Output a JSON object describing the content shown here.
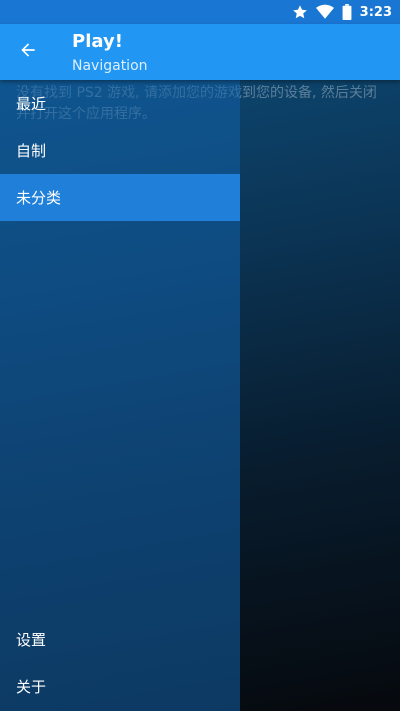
{
  "status_bar": {
    "time": "3:23",
    "icons": [
      "star-icon",
      "wifi-icon",
      "battery-icon"
    ]
  },
  "app_bar": {
    "title": "Play!",
    "subtitle": "Navigation",
    "back_icon": "arrow-left-icon"
  },
  "main": {
    "empty_message": "没有找到 PS2 游戏, 请添加您的游戏到您的设备, 然后关闭并打开这个应用程序。"
  },
  "drawer": {
    "items": [
      {
        "label": "最近"
      },
      {
        "label": "自制"
      },
      {
        "label": "未分类",
        "selected": true
      }
    ],
    "bottom_items": [
      {
        "label": "设置"
      },
      {
        "label": "关于"
      }
    ]
  },
  "colors": {
    "status_bar": "#1976d2",
    "app_bar": "#2196f3",
    "selected_item": "#1f7fd9"
  }
}
